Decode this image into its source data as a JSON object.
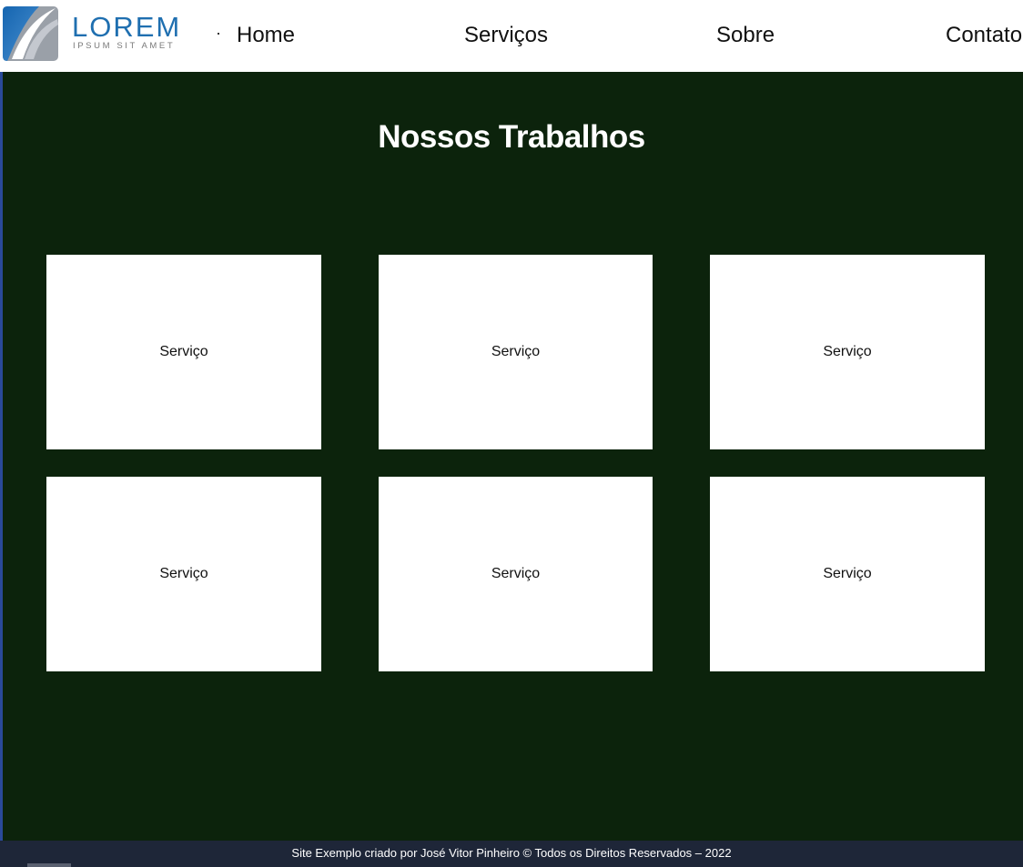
{
  "header": {
    "logo": {
      "title": "LOREM",
      "subtitle": "IPSUM SIT AMET"
    },
    "nav": [
      {
        "label": "Home"
      },
      {
        "label": "Serviços"
      },
      {
        "label": "Sobre"
      },
      {
        "label": "Contato"
      }
    ]
  },
  "main": {
    "title": "Nossos Trabalhos",
    "cards": [
      {
        "label": "Serviço"
      },
      {
        "label": "Serviço"
      },
      {
        "label": "Serviço"
      },
      {
        "label": "Serviço"
      },
      {
        "label": "Serviço"
      },
      {
        "label": "Serviço"
      }
    ]
  },
  "footer": {
    "text": "Site Exemplo criado por José Vitor Pinheiro © Todos os Direitos Reservados – 2022"
  },
  "colors": {
    "brand_blue": "#1f6fb0",
    "main_background": "#0c230c",
    "footer_background": "#1e2638"
  }
}
